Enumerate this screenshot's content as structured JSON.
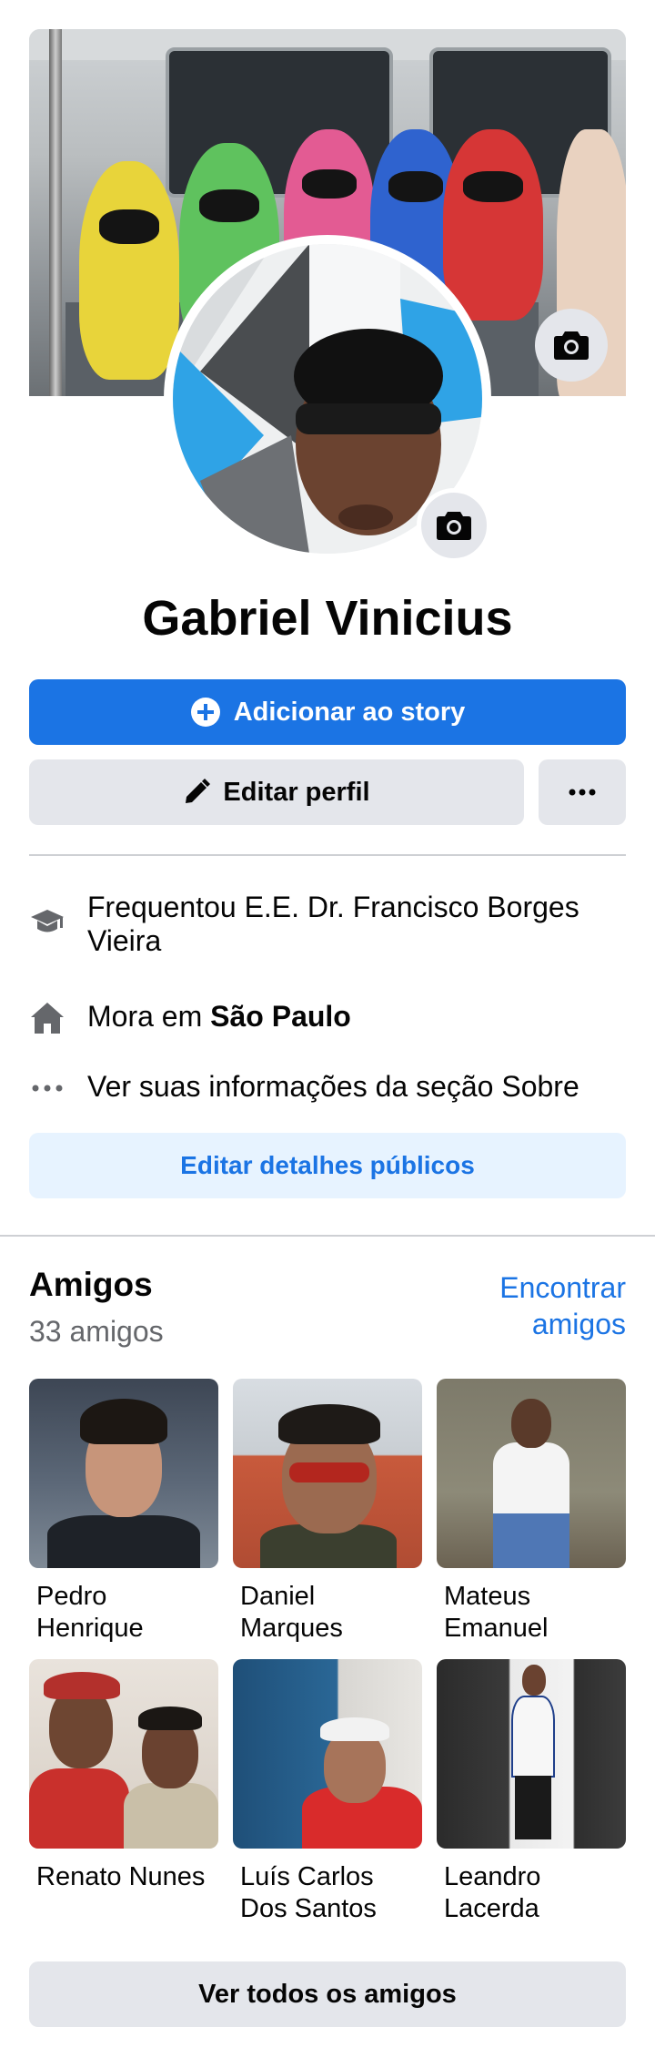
{
  "profile": {
    "name": "Gabriel Vinicius"
  },
  "actions": {
    "add_story_label": "Adicionar ao story",
    "edit_profile_label": "Editar perfil",
    "more_label": "···"
  },
  "info": {
    "education": "Frequentou E.E. Dr. Francisco Borges Vieira",
    "lives_prefix": "Mora em",
    "lives_city": "São Paulo",
    "about_link": "Ver suas informações da seção Sobre",
    "edit_details_label": "Editar detalhes públicos"
  },
  "friends": {
    "title": "Amigos",
    "count": "33 amigos",
    "find_label": "Encontrar amigos",
    "see_all_label": "Ver todos os amigos",
    "list": [
      {
        "name": "Pedro Henrique"
      },
      {
        "name": "Daniel Marques"
      },
      {
        "name": "Mateus Emanuel"
      },
      {
        "name": "Renato Nunes"
      },
      {
        "name": "Luís Carlos Dos Santos"
      },
      {
        "name": "Leandro Lacerda"
      }
    ]
  },
  "colors": {
    "accent": "#1b74e4",
    "secondary_bg": "#e4e6eb",
    "light_blue_bg": "#e7f3ff",
    "muted_text": "#65676b"
  },
  "icons": {
    "add_story": "plus-circle-icon",
    "edit_profile": "pencil-icon",
    "more": "ellipsis-icon",
    "camera": "camera-icon",
    "education": "graduation-cap-icon",
    "home": "house-icon",
    "about": "ellipsis-icon"
  }
}
